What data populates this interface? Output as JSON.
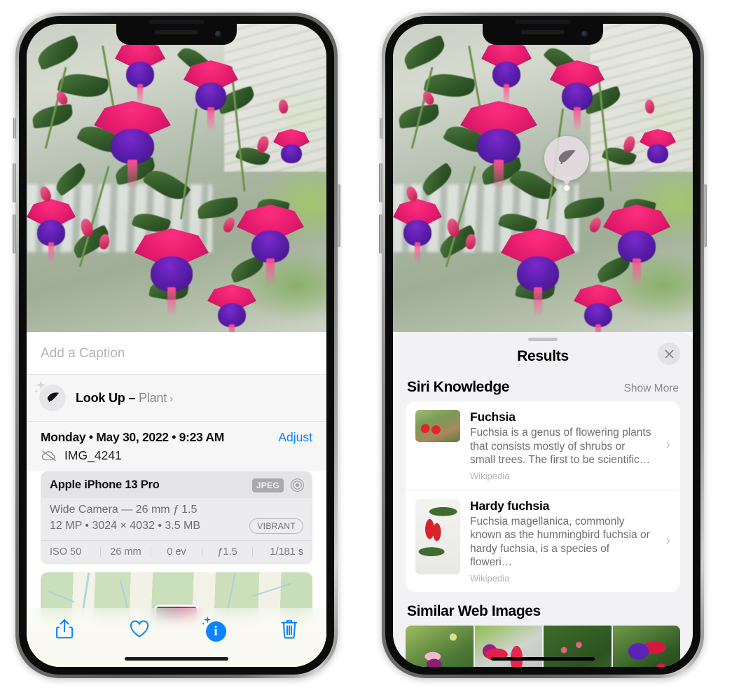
{
  "left_phone": {
    "caption_placeholder": "Add a Caption",
    "lookup": {
      "label": "Look Up – ",
      "subject": "Plant",
      "chevron": "›",
      "icon": "leaf-icon"
    },
    "date_line": "Monday • May 30, 2022 • 9:23 AM",
    "adjust_label": "Adjust",
    "file_name": "IMG_4241",
    "camera": {
      "model": "Apple iPhone 13 Pro",
      "format_badge": "JPEG",
      "lens": "Wide Camera — 26 mm ƒ 1.5",
      "specs": "12 MP • 3024 × 4032 • 3.5 MB",
      "style_badge": "VIBRANT",
      "exif": [
        "ISO 50",
        "26 mm",
        "0 ev",
        "ƒ1.5",
        "1/181 s"
      ]
    },
    "toolbar": [
      {
        "name": "share-button",
        "icon": "share-icon"
      },
      {
        "name": "favorite-button",
        "icon": "heart-icon"
      },
      {
        "name": "info-button",
        "icon": "info-sparkle-icon"
      },
      {
        "name": "delete-button",
        "icon": "trash-icon"
      }
    ]
  },
  "right_phone": {
    "pin_icon": "leaf-icon",
    "sheet_title": "Results",
    "close_label": "✕",
    "sections": [
      {
        "title": "Siri Knowledge",
        "action": "Show More",
        "items": [
          {
            "title": "Fuchsia",
            "description": "Fuchsia is a genus of flowering plants that consists mostly of shrubs or small trees. The first to be scientific…",
            "source": "Wikipedia",
            "chevron": "›"
          },
          {
            "title": "Hardy fuchsia",
            "description": "Fuchsia magellanica, commonly known as the hummingbird fuchsia or hardy fuchsia, is a species of floweri…",
            "source": "Wikipedia",
            "chevron": "›"
          }
        ]
      },
      {
        "title": "Similar Web Images",
        "thumbnails": [
          "web-image-1",
          "web-image-2",
          "web-image-3",
          "web-image-4"
        ]
      }
    ]
  },
  "colors": {
    "accent_blue": "#0a84ff",
    "sheet_bg": "#f2f2f5",
    "card_bg": "#ffffff",
    "secondary_text": "#6f6f75"
  }
}
